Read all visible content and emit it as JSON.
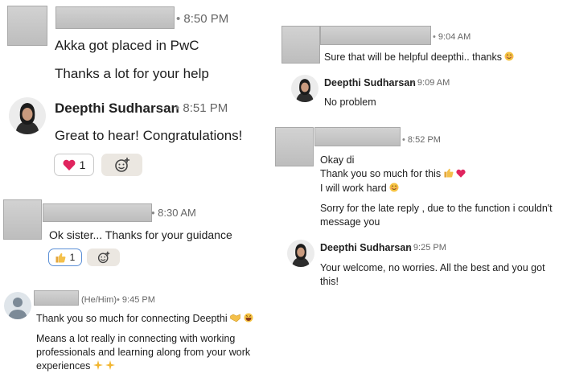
{
  "left": {
    "m1": {
      "time": "8:50 PM",
      "line1": "Akka got placed in PwC",
      "line2": "Thanks a lot for your help"
    },
    "m2": {
      "name": "Deepthi Sudharsan",
      "time": "8:51 PM",
      "text": "Great to hear! Congratulations!",
      "reaction_count": "1"
    },
    "m3": {
      "time": "8:30 AM",
      "text": "Ok sister... Thanks for your guidance",
      "reaction_count": "1"
    },
    "m4": {
      "pronouns": "(He/Him)",
      "time": "9:45 PM",
      "line1": "Thank you so much for connecting Deepthi",
      "line2": "Means a lot really in connecting with working",
      "line3": "professionals and learning along from your work",
      "line4": "experiences"
    }
  },
  "right": {
    "r1": {
      "time": "9:04 AM",
      "text": "Sure that will be helpful deepthi.. thanks"
    },
    "r2": {
      "name": "Deepthi Sudharsan",
      "time": "9:09 AM",
      "text": "No problem"
    },
    "r3": {
      "time": "8:52 PM",
      "line1": "Okay di",
      "line2": "Thank you so much for this",
      "line3": "I will work hard",
      "line4": "Sorry for the late reply , due to the function i couldn't",
      "line5": "message you"
    },
    "r4": {
      "name": "Deepthi Sudharsan",
      "time": "9:25 PM",
      "line1": "Your welcome, no worries. All the best and you got",
      "line2": "this!"
    }
  },
  "icons": {
    "heart": "heart-icon",
    "thumbs_up": "thumbs-up-icon",
    "add_reaction": "add-reaction-icon",
    "smile": "smiling-face-emoji",
    "sparkles": "sparkles-emoji",
    "handshake": "handshake-emoji",
    "grin": "grinning-face-emoji"
  },
  "colors": {
    "heart": "#e0245e",
    "reaction_border_blue": "#5b8fd6",
    "add_reaction_bg": "#ebe7e1"
  }
}
